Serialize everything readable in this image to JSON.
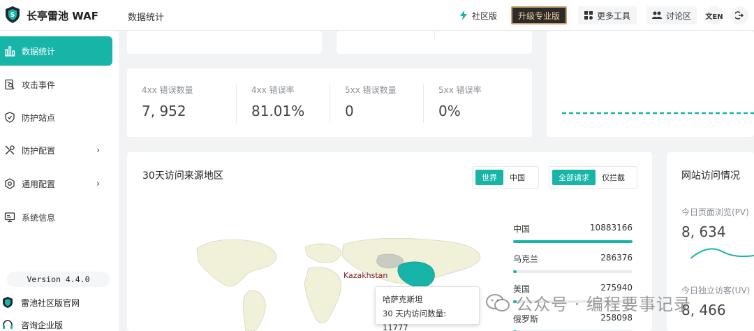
{
  "app": {
    "brand": "长亭雷池 WAF",
    "page_title": "数据统计"
  },
  "header": {
    "community_label": "社区版",
    "upgrade_label": "升级专业版",
    "tools_label": "更多工具",
    "forum_label": "讨论区",
    "lang_label": "文EN",
    "icons": {
      "community": "lightning-icon",
      "tools": "apps-icon",
      "forum": "users-icon",
      "lang": "translate-icon",
      "logout": "logout-icon"
    }
  },
  "sidebar": {
    "items": [
      {
        "label": "数据统计",
        "icon": "bar-chart-icon",
        "active": true
      },
      {
        "label": "攻击事件",
        "icon": "document-search-icon"
      },
      {
        "label": "防护站点",
        "icon": "shield-check-icon"
      },
      {
        "label": "防护配置",
        "icon": "tools-icon",
        "arrow": "›"
      },
      {
        "label": "通用配置",
        "icon": "gear-hex-icon",
        "arrow": "›"
      },
      {
        "label": "系统信息",
        "icon": "monitor-icon"
      }
    ],
    "version": "Version 4.4.0",
    "links": [
      {
        "label": "雷池社区版官网",
        "icon": "shield-logo-icon"
      },
      {
        "label": "咨询企业版",
        "icon": "headset-icon"
      }
    ]
  },
  "stats": [
    {
      "label": "4xx 错误数量",
      "value": "7, 952"
    },
    {
      "label": "4xx 错误率",
      "value": "81.01%"
    },
    {
      "label": "5xx 错误数量",
      "value": "0"
    },
    {
      "label": "5xx 错误率",
      "value": "0%"
    }
  ],
  "region": {
    "title": "30天访问来源地区",
    "scope_tabs": [
      "世界",
      "中国"
    ],
    "filter_tabs": [
      "全部请求",
      "仅拦截"
    ],
    "map_label": "Kazakhstan",
    "ranking": [
      {
        "name": "中国",
        "count": "10883166",
        "share": 1.0
      },
      {
        "name": "乌克兰",
        "count": "286376",
        "share": 0.026
      },
      {
        "name": "美国",
        "count": "275940",
        "share": 0.025
      },
      {
        "name": "俄罗斯",
        "count": "258098",
        "share": 0.024
      }
    ],
    "tooltip": {
      "title": "哈萨克斯坦",
      "text": "30 天内访问数量: 11777"
    }
  },
  "visits": {
    "title": "网站访问情况",
    "pv_label": "今日页面浏览(PV)",
    "pv_value": "8, 634",
    "uv_label": "今日独立访客(UV)",
    "uv_value": "8, 466"
  },
  "watermark": {
    "text": "公众号 · 编程要事记录",
    "icon": "wechat-icon"
  },
  "colors": {
    "accent": "#17b5a8",
    "upgrade_bg": "#2b2b2b",
    "upgrade_text": "#f5d29a"
  }
}
